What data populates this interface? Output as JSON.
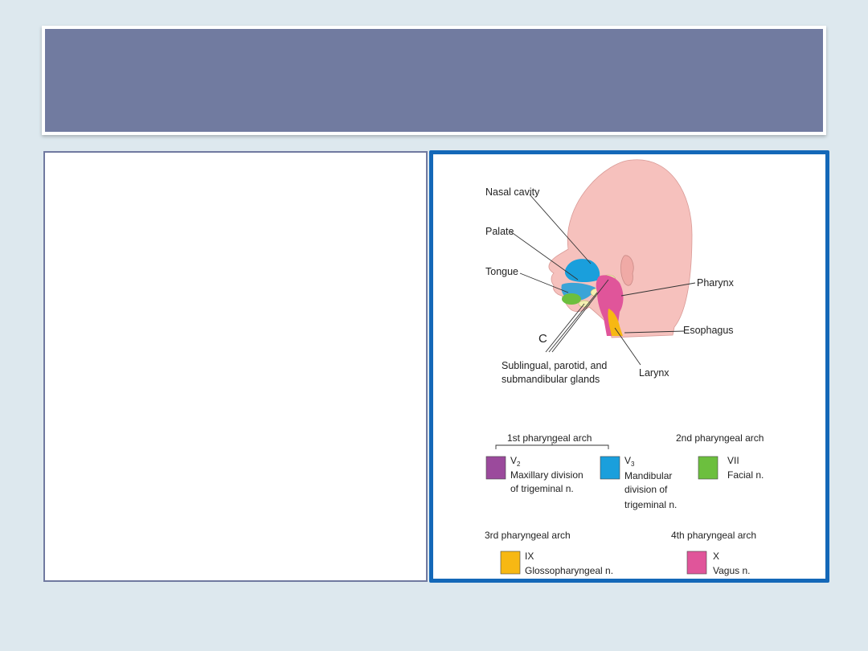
{
  "slide": {
    "title": ""
  },
  "diagram": {
    "panel_letter": "C",
    "labels": {
      "nasal_cavity": "Nasal cavity",
      "palate": "Palate",
      "tongue": "Tongue",
      "pharynx": "Pharynx",
      "esophagus": "Esophagus",
      "larynx": "Larynx",
      "glands_line1": "Sublingual, parotid, and",
      "glands_line2": "submandibular glands"
    },
    "legend": {
      "arch1": {
        "title": "1st pharyngeal arch",
        "v2": {
          "code": "V",
          "sub": "2",
          "line1": "Maxillary division",
          "line2": "of trigeminal n.",
          "color": "#9b4a9c"
        },
        "v3": {
          "code": "V",
          "sub": "3",
          "line1": "Mandibular",
          "line2": "division of",
          "line3": "trigeminal n.",
          "color": "#1a9fdc"
        }
      },
      "arch2": {
        "title": "2nd pharyngeal arch",
        "code": "VII",
        "line1": "Facial n.",
        "color": "#6cbf3e"
      },
      "arch3": {
        "title": "3rd pharyngeal arch",
        "code": "IX",
        "line1": "Glossopharyngeal n.",
        "color": "#f7b813"
      },
      "arch4": {
        "title": "4th pharyngeal arch",
        "code": "X",
        "line1": "Vagus n.",
        "color": "#e0559a"
      }
    }
  }
}
